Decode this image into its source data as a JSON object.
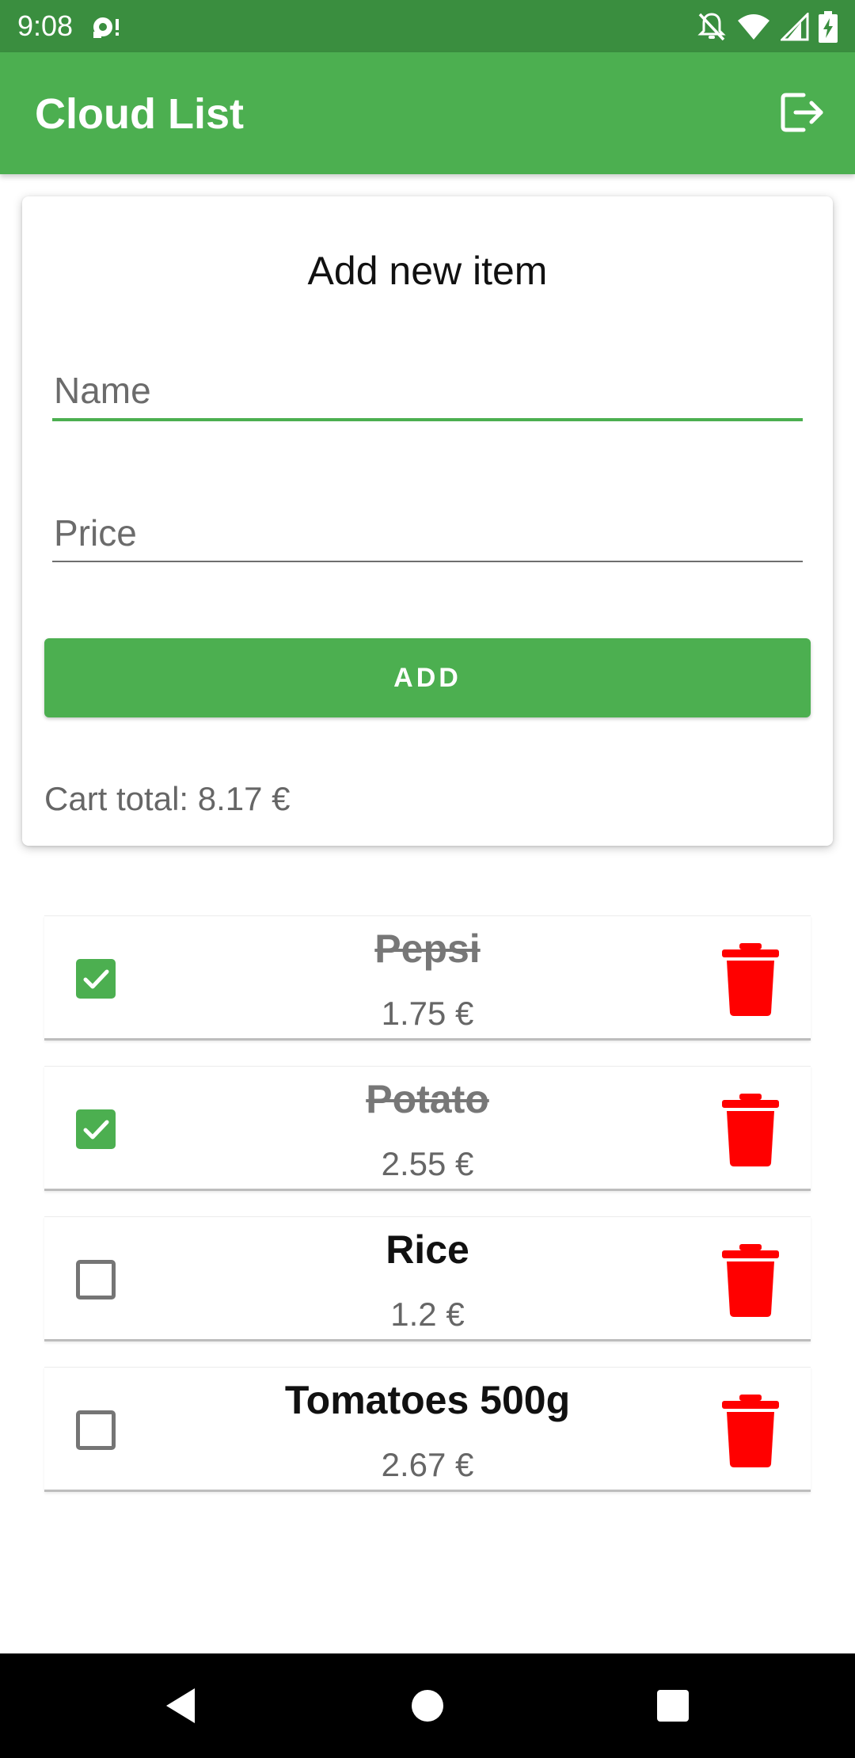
{
  "status_bar": {
    "time": "9:08",
    "icons": [
      "notification-icon",
      "mute-icon",
      "wifi-icon",
      "signal-icon",
      "battery-charging-icon"
    ]
  },
  "app_bar": {
    "title": "Cloud List",
    "action_icon": "logout-icon"
  },
  "add_form": {
    "title": "Add new item",
    "name_field": {
      "placeholder": "Name",
      "value": ""
    },
    "price_field": {
      "placeholder": "Price",
      "value": ""
    },
    "add_button_label": "ADD",
    "cart_total": "Cart total: 8.17 €"
  },
  "items": [
    {
      "name": "Pepsi",
      "price": "1.75 €",
      "checked": true
    },
    {
      "name": "Potato",
      "price": "2.55 €",
      "checked": true
    },
    {
      "name": "Rice",
      "price": "1.2 €",
      "checked": false
    },
    {
      "name": "Tomatoes 500g",
      "price": "2.67 €",
      "checked": false
    }
  ],
  "colors": {
    "primary": "#4caf50",
    "primary_dark": "#3a8e3f",
    "delete": "#ff0000"
  },
  "nav_bar": {
    "icons": [
      "back-icon",
      "home-icon",
      "recents-icon"
    ]
  }
}
